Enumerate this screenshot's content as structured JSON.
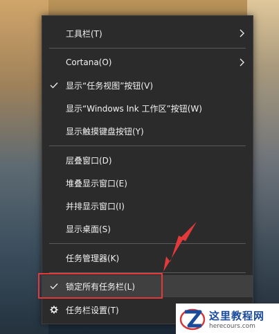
{
  "menu": {
    "items": [
      {
        "label": "工具栏(T)",
        "checked": false,
        "submenu": true
      },
      {
        "label": "Cortana(O)",
        "checked": false,
        "submenu": true
      },
      {
        "label": "显示“任务视图”按钮(V)",
        "checked": true,
        "submenu": false
      },
      {
        "label": "显示“Windows Ink 工作区”按钮(W)",
        "checked": false,
        "submenu": false
      },
      {
        "label": "显示触摸键盘按钮(Y)",
        "checked": false,
        "submenu": false
      },
      {
        "label": "层叠窗口(D)",
        "checked": false,
        "submenu": false
      },
      {
        "label": "堆叠显示窗口(E)",
        "checked": false,
        "submenu": false
      },
      {
        "label": "并排显示窗口(I)",
        "checked": false,
        "submenu": false
      },
      {
        "label": "显示桌面(S)",
        "checked": false,
        "submenu": false
      },
      {
        "label": "任务管理器(K)",
        "checked": false,
        "submenu": false
      },
      {
        "label": "锁定所有任务栏(L)",
        "checked": true,
        "submenu": false,
        "highlighted": true
      },
      {
        "label": "任务栏设置(T)",
        "checked": false,
        "submenu": false,
        "icon": "gear-icon"
      }
    ]
  },
  "watermark": {
    "title": "这里教程网",
    "url": "herecours.com"
  },
  "colors": {
    "menu_bg": "#2b2b2b",
    "menu_text": "#f2f2f2",
    "highlight_bg": "#404040",
    "annotation_red": "#e23a3a",
    "watermark_blue": "#1a4a9a"
  }
}
